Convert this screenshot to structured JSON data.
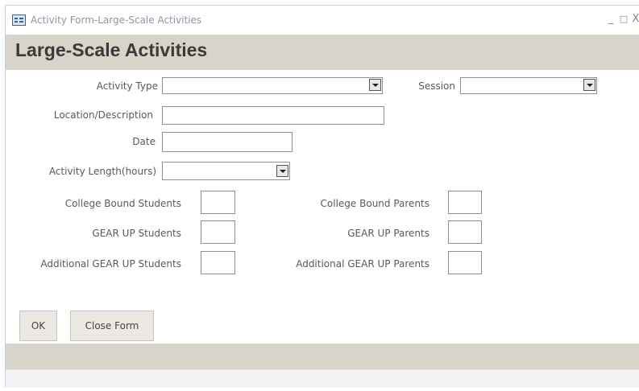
{
  "window": {
    "title": "Activity Form-Large-Scale Activities",
    "minimize_glyph": "_",
    "maximize_glyph": "□",
    "close_glyph": "X"
  },
  "form": {
    "heading": "Large-Scale Activities",
    "fields": {
      "activity_type": {
        "label": "Activity Type",
        "value": ""
      },
      "session": {
        "label": "Session",
        "value": ""
      },
      "location": {
        "label": "Location/Description",
        "value": ""
      },
      "date": {
        "label": "Date",
        "value": ""
      },
      "activity_length": {
        "label": "Activity Length(hours)",
        "value": ""
      },
      "cb_students": {
        "label": "College Bound Students",
        "value": ""
      },
      "cb_parents": {
        "label": "College Bound Parents",
        "value": ""
      },
      "gu_students": {
        "label": "GEAR UP Students",
        "value": ""
      },
      "gu_parents": {
        "label": "GEAR UP Parents",
        "value": ""
      },
      "add_gu_students": {
        "label": "Additional GEAR UP Students",
        "value": ""
      },
      "add_gu_parents": {
        "label": "Additional GEAR UP Parents",
        "value": ""
      }
    },
    "buttons": {
      "ok": "OK",
      "close": "Close Form"
    }
  },
  "colors": {
    "band": "#d9d4ca",
    "title_text": "#3a3a3a"
  }
}
